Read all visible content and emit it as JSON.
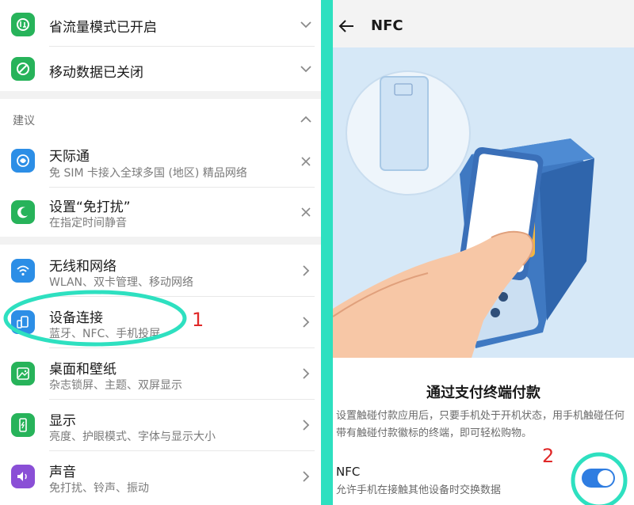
{
  "left": {
    "status_rows": [
      {
        "title": "省流量模式已开启",
        "icon": "data-saver-icon"
      },
      {
        "title": "移动数据已关闭",
        "icon": "mobile-data-off-icon"
      }
    ],
    "suggestion_header": "建议",
    "suggestions": [
      {
        "title": "天际通",
        "subtitle": "免 SIM 卡接入全球多国 (地区) 精品网络",
        "icon": "skytone-icon"
      },
      {
        "title": "设置“免打扰”",
        "subtitle": "在指定时间静音",
        "icon": "moon-icon"
      }
    ],
    "settings": [
      {
        "title": "无线和网络",
        "subtitle": "WLAN、双卡管理、移动网络",
        "icon": "wifi-icon"
      },
      {
        "title": "设备连接",
        "subtitle": "蓝牙、NFC、手机投屏",
        "icon": "device-connection-icon"
      },
      {
        "title": "桌面和壁纸",
        "subtitle": "杂志锁屏、主题、双屏显示",
        "icon": "wallpaper-icon"
      },
      {
        "title": "显示",
        "subtitle": "亮度、护眼模式、字体与显示大小",
        "icon": "display-icon"
      },
      {
        "title": "声音",
        "subtitle": "免打扰、铃声、振动",
        "icon": "sound-icon"
      }
    ]
  },
  "right": {
    "header_title": "NFC",
    "section_title": "通过支付终端付款",
    "description": "设置触碰付款应用后，只要手机处于开机状态，用手机触碰任何带有触碰付款徽标的终端，即可轻松购物。",
    "nfc_label": "NFC",
    "nfc_subtitle": "允许手机在接触其他设备时交换数据",
    "nfc_enabled": true
  },
  "annotations": {
    "step1": "1",
    "step2": "2"
  },
  "colors": {
    "accent_teal": "#2ee0c0",
    "toggle_blue": "#2f7de1",
    "annotation_red": "#e02828",
    "illustration_bg": "#d6e8f7"
  }
}
